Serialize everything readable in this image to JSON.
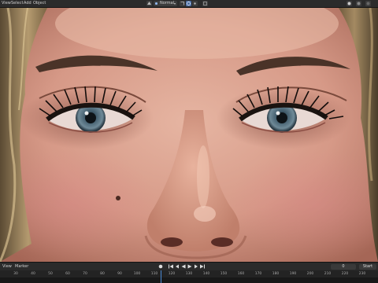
{
  "header": {
    "menus": [
      "View",
      "Select",
      "Add",
      "Object"
    ],
    "shading_mode": "Normal",
    "icons": [
      "viewport-shading-icon",
      "overlay-icon",
      "xray-icon",
      "snap-icon",
      "proportional-edit-icon",
      "transform-orientation-icon"
    ]
  },
  "timeline": {
    "menus": [
      "View",
      "Marker"
    ],
    "current_frame": "0",
    "start_label": "Start",
    "ruler_ticks": [
      "30",
      "40",
      "50",
      "60",
      "70",
      "80",
      "90",
      "100",
      "110",
      "120",
      "130",
      "140",
      "150",
      "160",
      "170",
      "180",
      "190",
      "200",
      "210",
      "220",
      "230"
    ],
    "playback_icons": [
      "jump-start-icon",
      "prev-key-icon",
      "play-reverse-icon",
      "play-icon",
      "next-key-icon",
      "jump-end-icon"
    ]
  },
  "colors": {
    "header_bg": "#2b2b2b",
    "accent": "#4b6da3",
    "playhead": "#4b8bd6",
    "skin": "#d79a86",
    "iris": "#4f6a7c"
  }
}
